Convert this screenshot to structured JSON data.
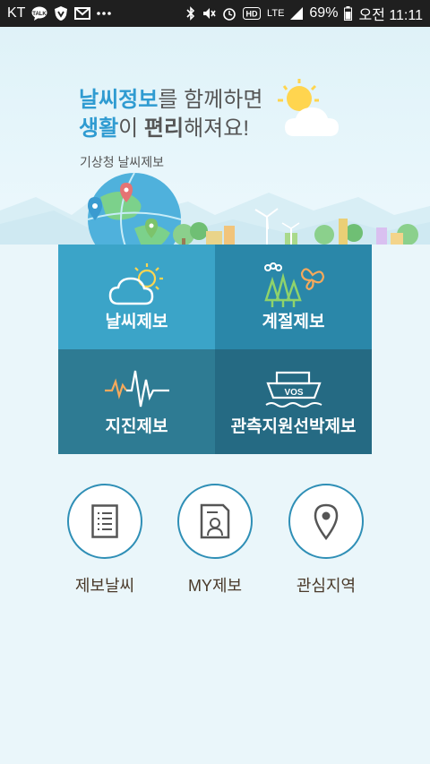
{
  "status_bar": {
    "carrier": "KT",
    "battery": "69%",
    "time": "오전 11:11",
    "lte": "LTE",
    "notification_icons": [
      "talk-icon",
      "shield-icon",
      "mail-icon",
      "more-dots"
    ]
  },
  "hero": {
    "line1_blue": "날씨정보",
    "line1_rest": "를 함께하면",
    "line2_blue1": "생활",
    "line2_mid": "이 ",
    "line2_bold": "편리",
    "line2_rest": "해져요!",
    "subtitle": "기상청 날씨제보"
  },
  "tiles": [
    {
      "label": "날씨제보",
      "icon": "cloud-sun-icon"
    },
    {
      "label": "계절제보",
      "icon": "trees-butterfly-icon"
    },
    {
      "label": "지진제보",
      "icon": "seismograph-icon"
    },
    {
      "label": "관측지원선박제보",
      "icon": "ship-icon"
    }
  ],
  "buttons": [
    {
      "label": "제보날씨",
      "icon": "document-list-icon"
    },
    {
      "label": "MY제보",
      "icon": "profile-card-icon"
    },
    {
      "label": "관심지역",
      "icon": "location-pin-icon"
    }
  ],
  "ship_text": "VOS",
  "colors": {
    "tile1": "#3ba4c8",
    "tile2": "#2a87a9",
    "tile3": "#2e7b93",
    "tile4": "#256a83",
    "accent": "#2f9bd1"
  }
}
